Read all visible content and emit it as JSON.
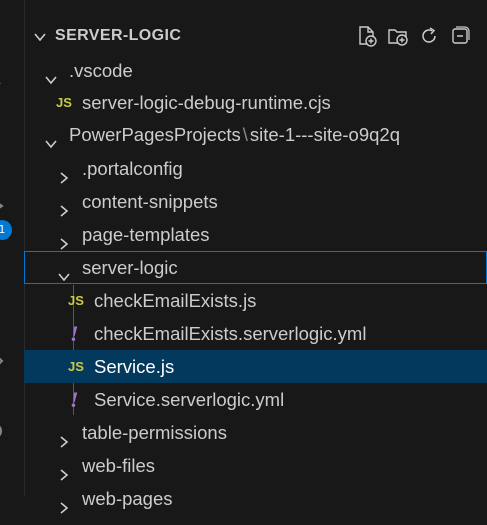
{
  "explorer": {
    "section_title": "SERVER-LOGIC",
    "actions": [
      {
        "icon": "new-file-icon"
      },
      {
        "icon": "new-folder-icon"
      },
      {
        "icon": "refresh-icon"
      },
      {
        "icon": "collapse-all-icon"
      }
    ]
  },
  "activity_bar": {
    "badge": "1"
  },
  "tree": {
    "vscode": ".vscode",
    "debug_runtime": "server-logic-debug-runtime.cjs",
    "pp_projects": "PowerPagesProjects",
    "pp_sep": "\\",
    "site": "site-1---site-o9q2q",
    "portalconfig": ".portalconfig",
    "content_snippets": "content-snippets",
    "page_templates": "page-templates",
    "server_logic": "server-logic",
    "check_email_js": "checkEmailExists.js",
    "check_email_yml": "checkEmailExists.serverlogic.yml",
    "service_js": "Service.js",
    "service_yml": "Service.serverlogic.yml",
    "table_permissions": "table-permissions",
    "web_files": "web-files",
    "web_pages": "web-pages"
  },
  "file_badges": {
    "js": "JS",
    "yml": "!"
  },
  "colors": {
    "background": "#181818",
    "selection": "#04395e",
    "focus_border": "#0078d4",
    "js": "#cbcb41",
    "yml": "#a074c4"
  }
}
